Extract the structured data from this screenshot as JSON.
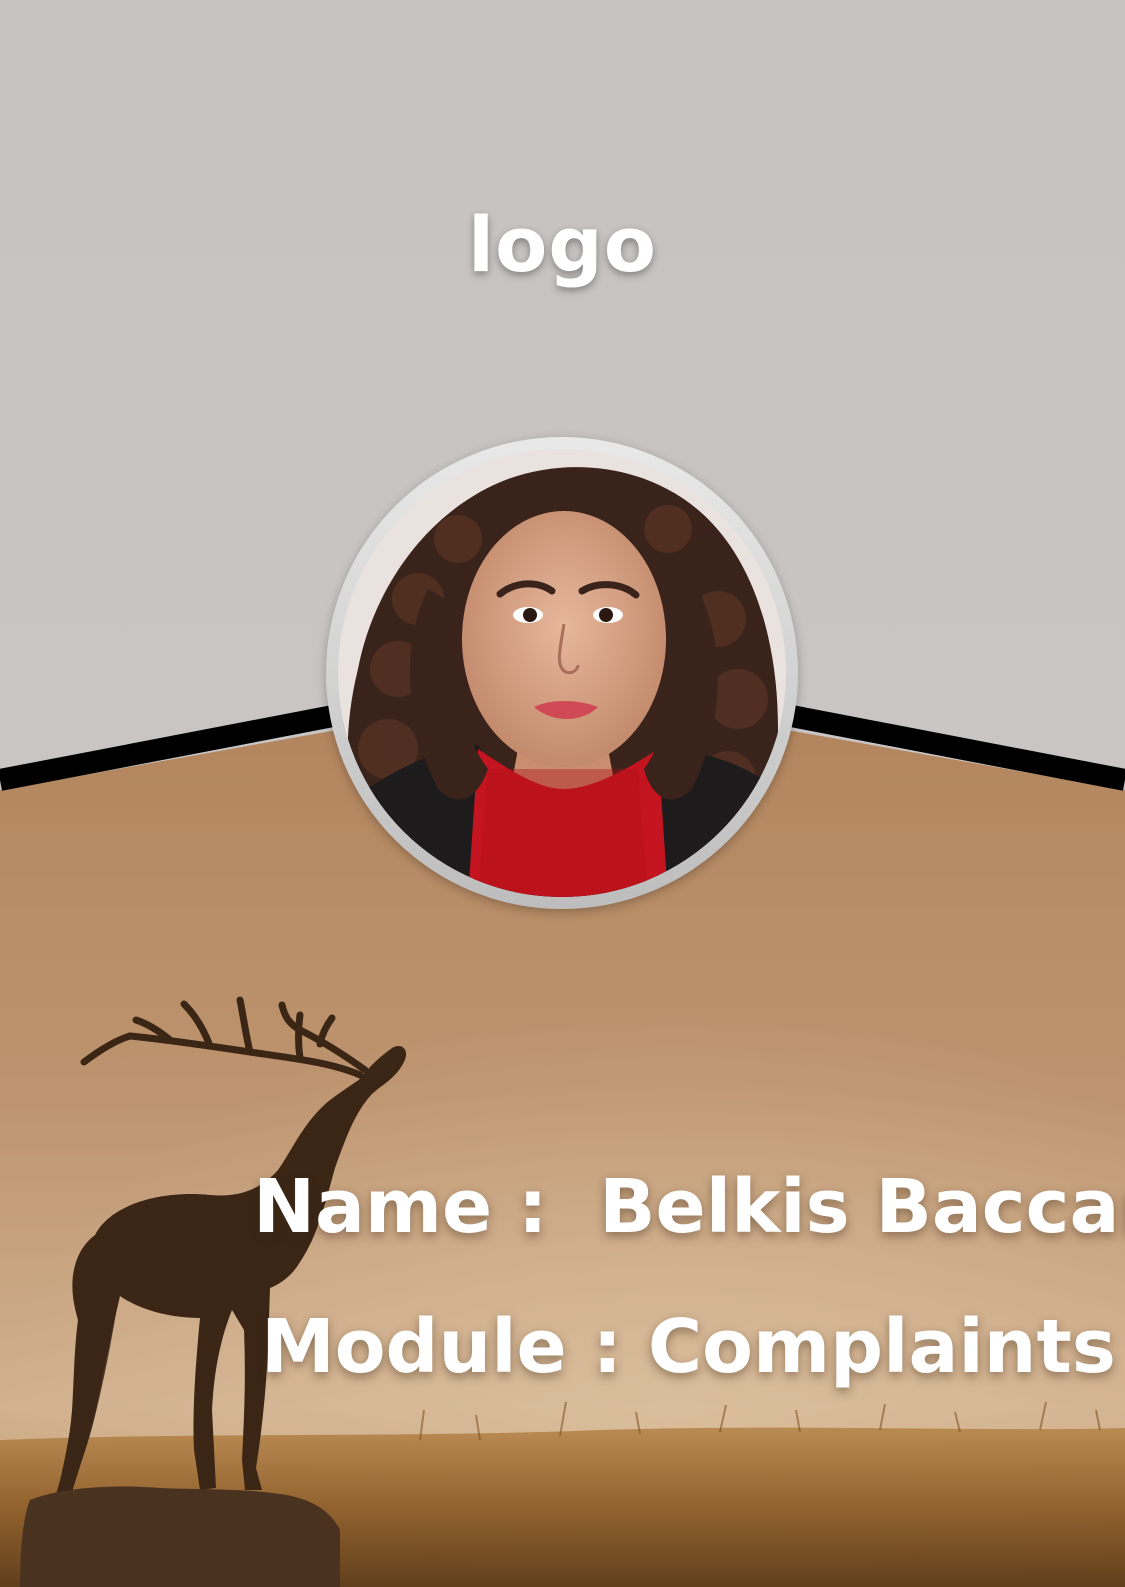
{
  "card": {
    "logo_text": "logo",
    "name_label": "Name :",
    "name_value": "Belkis Baccar",
    "module_label": "Module :",
    "module_value": "Complaints"
  },
  "colors": {
    "top_background": "#c6c3c2",
    "bottom_gradient_top": "#b88a60",
    "bottom_gradient_bottom": "#c9a47d",
    "separator_line": "#000000",
    "text": "#ffffff"
  },
  "images": {
    "avatar": "profile-photo",
    "background": "deer-silhouette-savanna"
  }
}
